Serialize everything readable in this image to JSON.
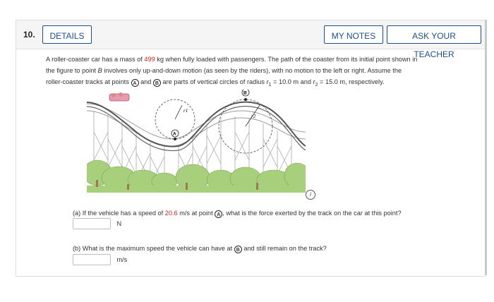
{
  "question": {
    "number": "10.",
    "buttons": {
      "details": "DETAILS",
      "notes": "MY NOTES",
      "ask": "ASK YOUR TEACHER"
    },
    "text": {
      "p1": "A roller-coaster car has a mass of ",
      "mass": "499",
      "p2": " kg when fully loaded with passengers. The path of the coaster from its initial point shown in",
      "line2_a": "the figure to point ",
      "line2_b": "B",
      "line2_c": " involves only up-and-down motion (as seen by the riders), with no motion to the left or right. Assume the",
      "line3_a": "roller-coaster tracks at points ",
      "point_a": "A",
      "and": " and ",
      "point_b": "B",
      "line3_b": " are parts of vertical circles of radius ",
      "r1": "r",
      "r1_sub": "1",
      "r1_val": " = 10.0 m and ",
      "r2": "r",
      "r2_sub": "2",
      "r2_val": " = 15.0 m, respectively."
    },
    "figure": {
      "label_r1": "r1",
      "label_r2": "r2",
      "label_a": "A",
      "label_b": "B",
      "info_icon": "i"
    },
    "parts": {
      "a": {
        "prefix": "(a) If the vehicle has a speed of ",
        "speed": "20.6",
        "mid": " m/s at point ",
        "point": "A",
        "suffix": ", what is the force exerted by the track on the car at this point?",
        "unit": "N",
        "value": ""
      },
      "b": {
        "prefix": "(b) What is the maximum speed the vehicle can have at ",
        "point": "B",
        "suffix": " and still remain on the track?",
        "unit": "m/s",
        "value": ""
      }
    }
  },
  "colors": {
    "accent": "#1f4e8c",
    "red_value": "#cc2222",
    "header_bg": "#f5f5f5",
    "tree_green": "#a7cf7c"
  }
}
